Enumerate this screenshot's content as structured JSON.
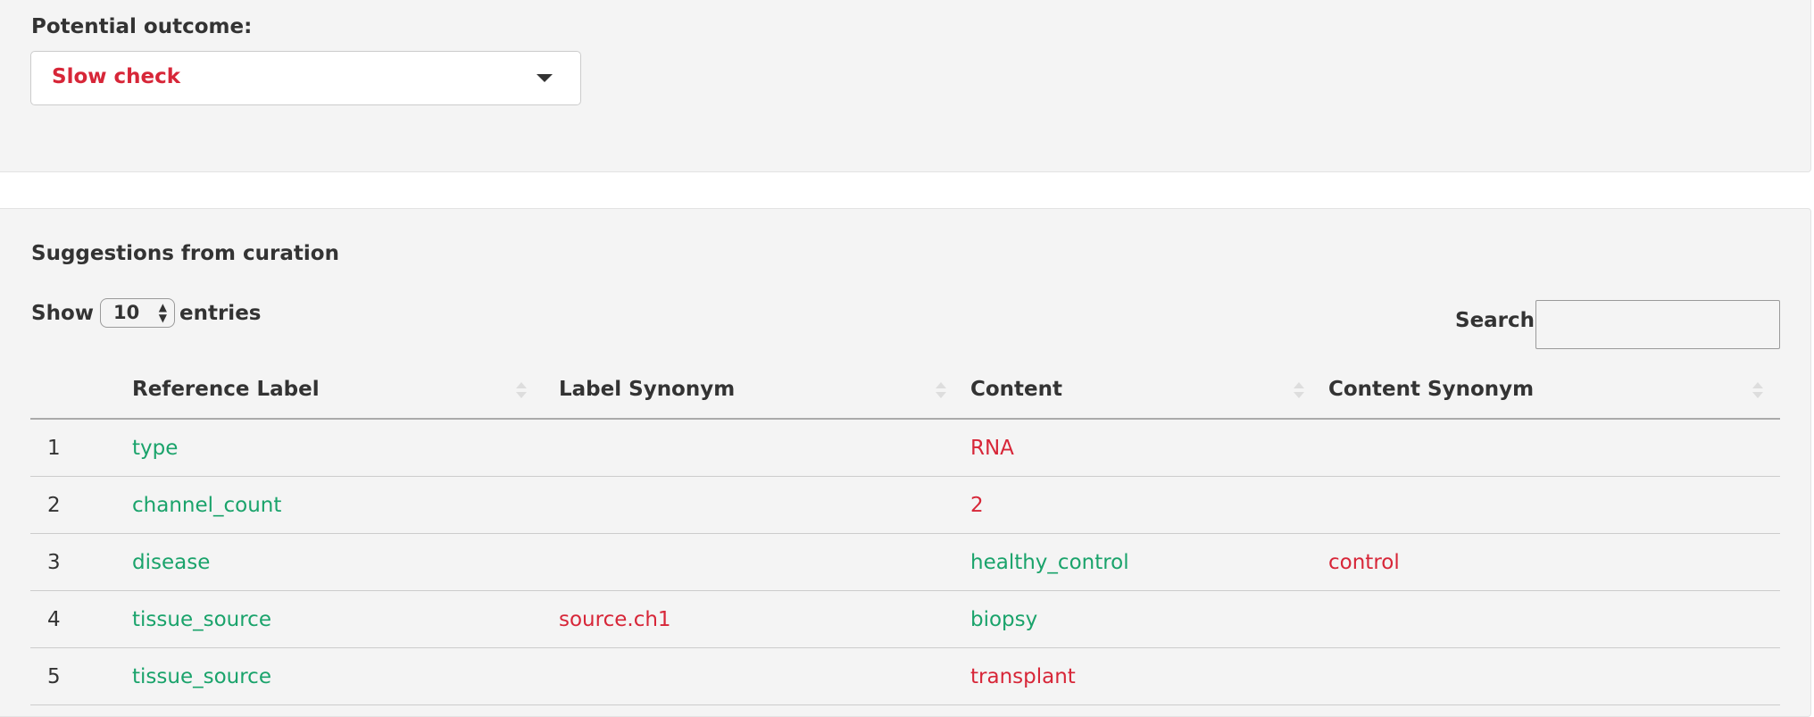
{
  "outcome": {
    "label": "Potential outcome:",
    "selected": "Slow check"
  },
  "suggestions": {
    "title": "Suggestions from curation",
    "length_menu": {
      "prefix": "Show",
      "value": "10",
      "suffix": "entries"
    },
    "search": {
      "label": "Search:",
      "value": ""
    },
    "columns": [
      "",
      "Reference Label",
      "Label Synonym",
      "Content",
      "Content Synonym"
    ],
    "rows": [
      {
        "n": "1",
        "ref": "type",
        "lsyn": "",
        "content": "RNA",
        "csyn": ""
      },
      {
        "n": "2",
        "ref": "channel_count",
        "lsyn": "",
        "content": "2",
        "csyn": ""
      },
      {
        "n": "3",
        "ref": "disease",
        "lsyn": "",
        "content": "healthy_control",
        "csyn": "control"
      },
      {
        "n": "4",
        "ref": "tissue_source",
        "lsyn": "source.ch1",
        "content": "biopsy",
        "csyn": ""
      },
      {
        "n": "5",
        "ref": "tissue_source",
        "lsyn": "",
        "content": "transplant",
        "csyn": ""
      }
    ]
  },
  "colors": {
    "accent_red": "#d72638",
    "accent_green": "#1aa36b",
    "panel_bg": "#f4f4f4"
  }
}
